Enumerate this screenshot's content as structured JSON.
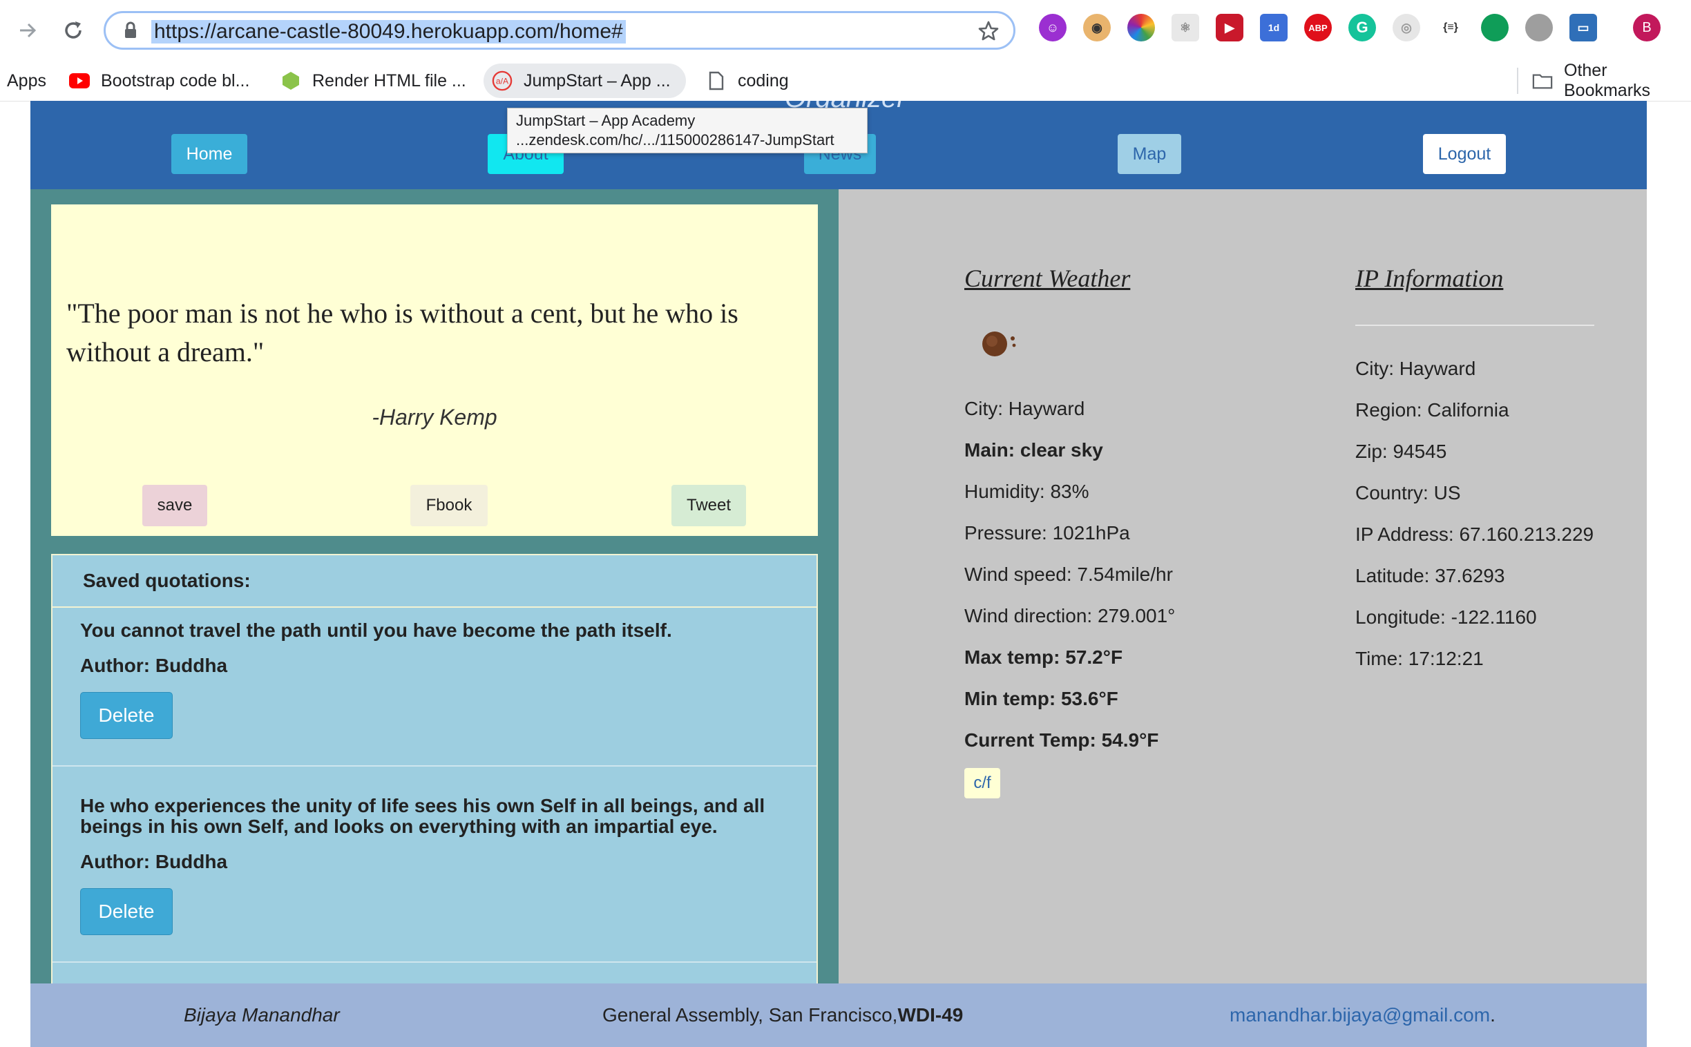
{
  "browser": {
    "url": "https://arcane-castle-80049.herokuapp.com/home#",
    "avatar_letter": "B",
    "extensions": [
      "purple-face-icon",
      "owl-icon",
      "color-wheel-icon",
      "atom-icon",
      "video-icon",
      "calendar-icon",
      "adblock-icon",
      "grammarly-icon",
      "target-icon",
      "json-icon",
      "chat-bubble-icon",
      "brain-icon",
      "monitor-icon"
    ],
    "ext_labels": {
      "calendar": "1d",
      "adblock": "ABP",
      "grammarly": "G",
      "json": "{≡}"
    }
  },
  "bookmarks": {
    "apps": "Apps",
    "items": [
      "Bootstrap code bl...",
      "Render HTML file ...",
      "JumpStart – App ...",
      "coding"
    ],
    "other": "Other Bookmarks"
  },
  "tooltip": {
    "line1": "JumpStart – App Academy",
    "line2": "...zendesk.com/hc/.../115000286147-JumpStart"
  },
  "navbar": {
    "brand": "Organizer",
    "home": "Home",
    "about": "About",
    "news": "News",
    "map": "Map",
    "logout": "Logout"
  },
  "quote": {
    "text": "\"The poor man is not he who is without a cent, but he who is without a dream.\"",
    "author": "-Harry Kemp",
    "save": "save",
    "fbook": "Fbook",
    "tweet": "Tweet"
  },
  "saved": {
    "header": "Saved quotations:",
    "items": [
      {
        "quote": "You cannot travel the path until you have become the path itself.",
        "author": "Author: Buddha",
        "delete": "Delete"
      },
      {
        "quote": "He who experiences the unity of life sees his own Self in all beings, and all beings in his own Self, and looks on everything with an impartial eye.",
        "author": "Author: Buddha",
        "delete": "Delete"
      }
    ]
  },
  "weather": {
    "title": "Current Weather",
    "city": "City: Hayward",
    "main": "Main: clear sky",
    "humidity": "Humidity: 83%",
    "pressure": "Pressure: 1021hPa",
    "wind_speed": "Wind speed: 7.54mile/hr",
    "wind_direction": "Wind direction: 279.001°",
    "max_temp": "Max temp: 57.2°F",
    "min_temp": "Min temp: 53.6°F",
    "current_temp": "Current Temp: 54.9°F",
    "toggle": "c/f"
  },
  "ip": {
    "title": "IP Information",
    "city": "City: Hayward",
    "region": "Region: California",
    "zip": "Zip: 94545",
    "country": "Country: US",
    "ip_address": "IP Address: 67.160.213.229",
    "latitude": "Latitude: 37.6293",
    "longitude": "Longitude: -122.1160",
    "time": "Time: 17:12:21"
  },
  "footer": {
    "name": "Bijaya Manandhar",
    "org": "General Assembly, San Francisco,",
    "cohort": "WDI-49",
    "email": "manandhar.bijaya@gmail.com",
    "period": "."
  },
  "colors": {
    "navbar": "#2d66ab",
    "left_bg": "#4f8c8c",
    "right_bg": "#c6c6c6",
    "quote_bg": "#ffffd5",
    "saved_bg": "#9dcee0",
    "delete_btn": "#3fa9d6",
    "footer": "#9db3d8"
  }
}
